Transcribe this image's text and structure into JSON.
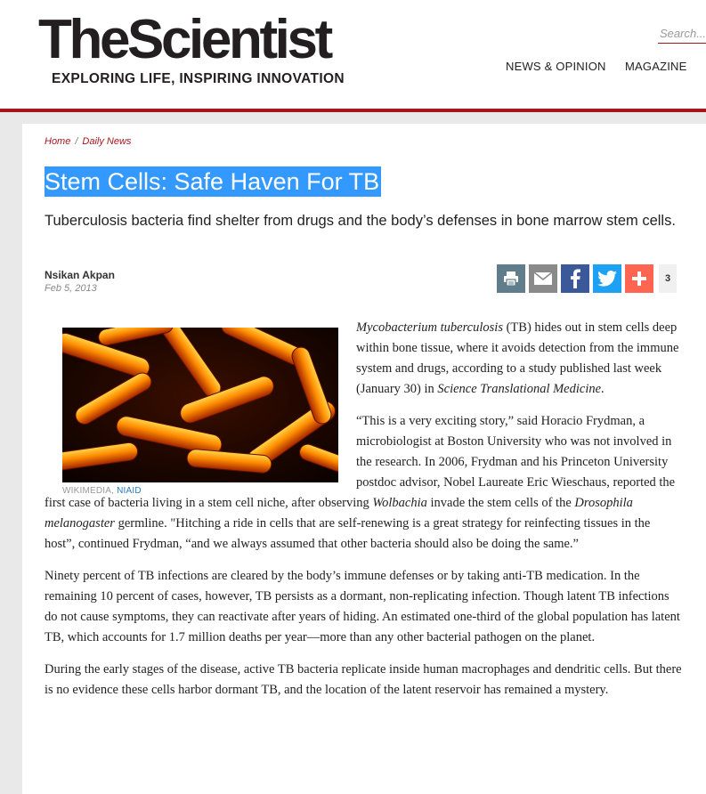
{
  "header": {
    "logo_text": "TheScientist",
    "tagline": "EXPLORING LIFE, INSPIRING INNOVATION",
    "search_placeholder": "Search...",
    "nav": [
      "NEWS & OPINION",
      "MAGAZINE"
    ]
  },
  "colors": {
    "brand_red": "#a4161d",
    "title_highlight": "#3399ff",
    "link_blue": "#2a7ab8"
  },
  "breadcrumb": [
    "Home",
    "Daily News"
  ],
  "article": {
    "title": "Stem Cells: Safe Haven For TB",
    "dek": "Tuberculosis bacteria find shelter from drugs and the body’s defenses in bone marrow stem cells.",
    "author": "Nsikan Akpan",
    "date": "Feb 5, 2013",
    "share": {
      "icons": [
        "print-icon",
        "email-icon",
        "facebook-icon",
        "twitter-icon",
        "plus-icon"
      ],
      "count": "3"
    },
    "image_caption": {
      "credit": "WIKIMEDIA,",
      "link": "NIAID"
    },
    "p1": {
      "species": "Mycobacterium tuberculosis",
      "text": " (TB) hides out in stem cells deep within bone tissue, where it avoids detection from the immune system and drugs, according to a study published last week (January 30) in ",
      "journal": "Science Translational Medicine",
      "end": "."
    },
    "p2": {
      "a": "“This is a very exciting story,” said Horacio Frydman, a microbiologist at Boston University who was not involved in the research. In 2006, Frydman and his Princeton University postdoc advisor, Nobel Laureate Eric Wieschaus, reported the first case of bacteria living in a stem cell niche, after observing ",
      "wolbachia": "Wolbachia",
      "b": " invade the stem cells of the ",
      "drosophila": "Drosophila melanogaster",
      "c": " germline. \"Hitching a ride in cells that are self-renewing is a great strategy for reinfecting tissues in the host”, continued Frydman, “and we always assumed that other bacteria should also be doing the same.”"
    },
    "p3": "Ninety percent of TB infections are cleared by the body’s immune defenses or by taking anti-TB medication. In the remaining 10 percent of cases, however, TB persists as a dormant, non-replicating infection. Though latent TB infections do not cause symptoms, they can reactivate after years of hiding. An estimated one-third of the global population has latent TB, which accounts for 1.7 million deaths per year—more than any other bacterial pathogen on the planet.",
    "p4": "During the early stages of the disease, active TB bacteria replicate inside human macrophages and dendritic cells. But there is no evidence these cells harbor dormant TB, and the location of the latent reservoir has remained a mystery."
  }
}
